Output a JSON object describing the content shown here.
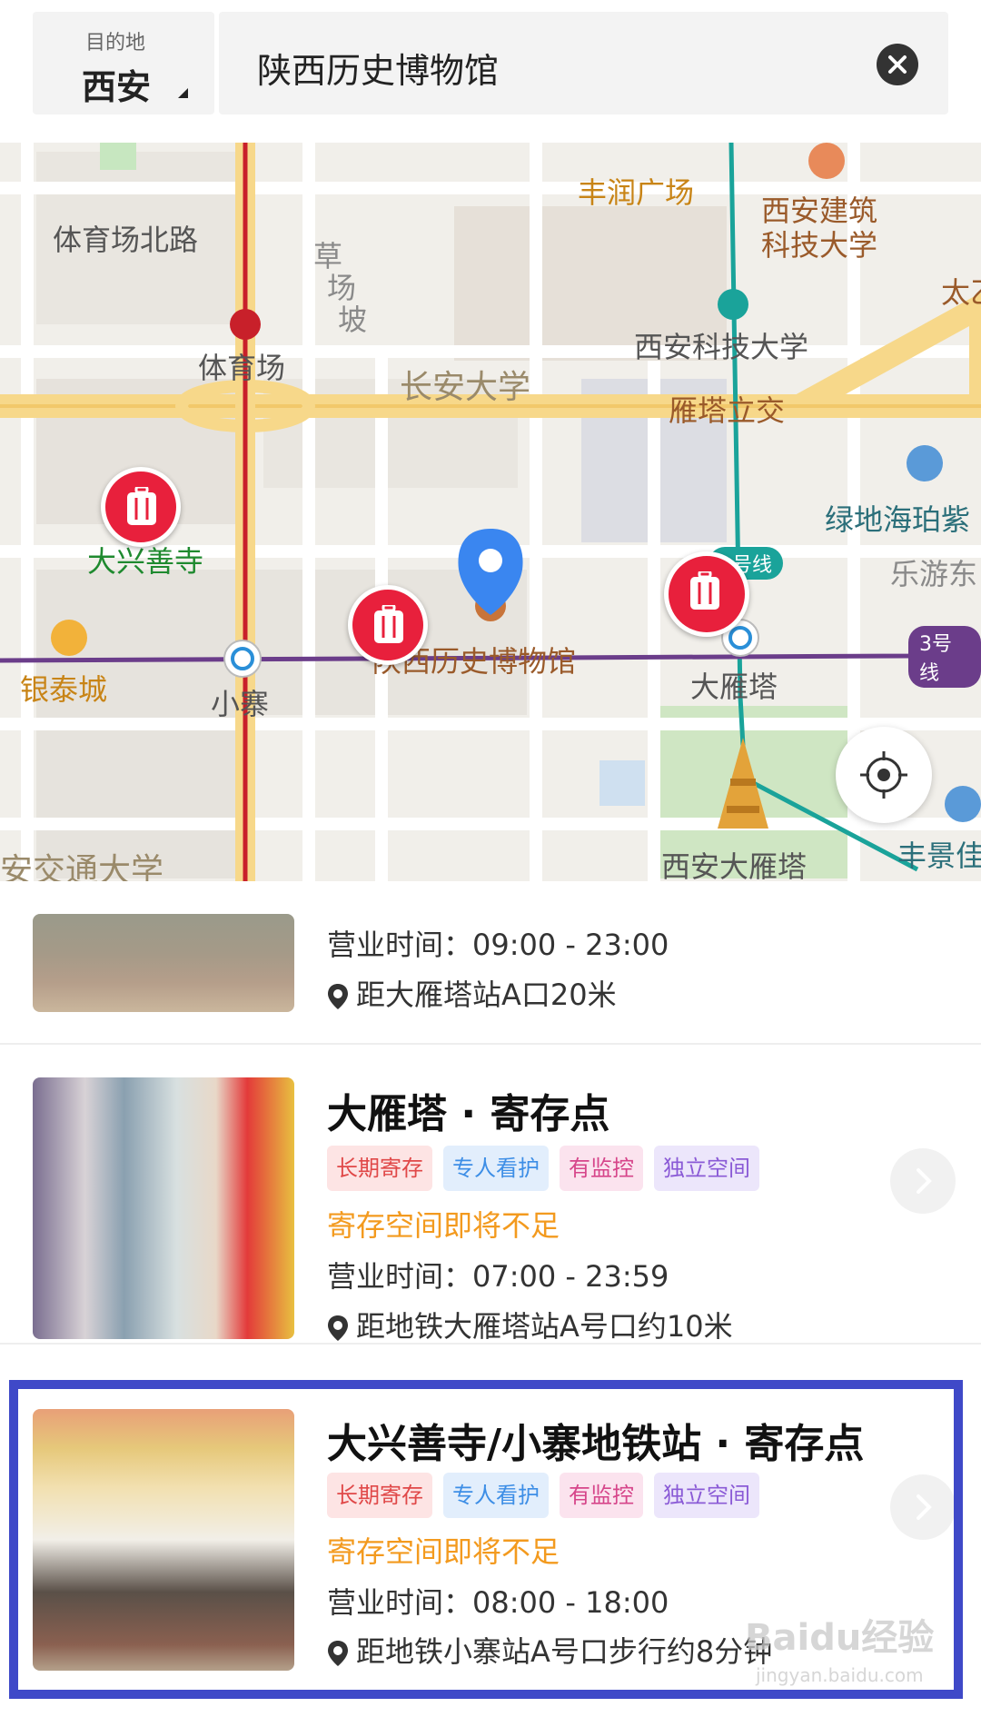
{
  "header": {
    "dest_label": "目的地",
    "city": "西安",
    "search_value": "陕西历史博物馆"
  },
  "map": {
    "labels": {
      "fengrun": "丰润广场",
      "jianzhu_1": "西安建筑",
      "jianzhu_2": "科技大学",
      "tai": "太乙",
      "tiyuchang_road": "体育场北路",
      "caochang_1": "草",
      "caochang_2": "场",
      "caochang_3": "坡",
      "tiyuchang": "体育场",
      "keji": "西安科技大学",
      "changan": "长安大学",
      "yanta_lijiao": "雁塔立交",
      "lvdi": "绿地海珀紫",
      "daxing": "大兴善寺",
      "leyou": "乐游东",
      "museum": "陕西历史博物馆",
      "yintai": "银泰城",
      "xiaozhai": "小寨",
      "dayanta_station": "大雁塔",
      "line1": "1号线",
      "line3": "3号线",
      "jiaotong": "安交通大学",
      "dayanta_pagoda": "西安大雁塔",
      "fengjing": "丰景佳"
    }
  },
  "cards": [
    {
      "title": "",
      "hours": "营业时间：09:00 - 23:00",
      "distance": "距大雁塔站A口20米"
    },
    {
      "title": "大雁塔 · 寄存点",
      "tags": [
        "长期寄存",
        "专人看护",
        "有监控",
        "独立空间"
      ],
      "warning": "寄存空间即将不足",
      "hours": "营业时间：07:00 - 23:59",
      "distance": "距地铁大雁塔站A号口约10米"
    },
    {
      "title": "大兴善寺/小寨地铁站 · 寄存点",
      "tags": [
        "长期寄存",
        "专人看护",
        "有监控",
        "独立空间"
      ],
      "warning": "寄存空间即将不足",
      "hours": "营业时间：08:00 - 18:00",
      "distance": "距地铁小寨站A号口步行约8分钟"
    }
  ],
  "watermark": {
    "main": "Baidu经验",
    "sub": "jingyan.baidu.com"
  },
  "colors": {
    "pin_red": "#e8203c",
    "accent_blue": "#3f49c8",
    "warning_orange": "#f39a1e"
  }
}
